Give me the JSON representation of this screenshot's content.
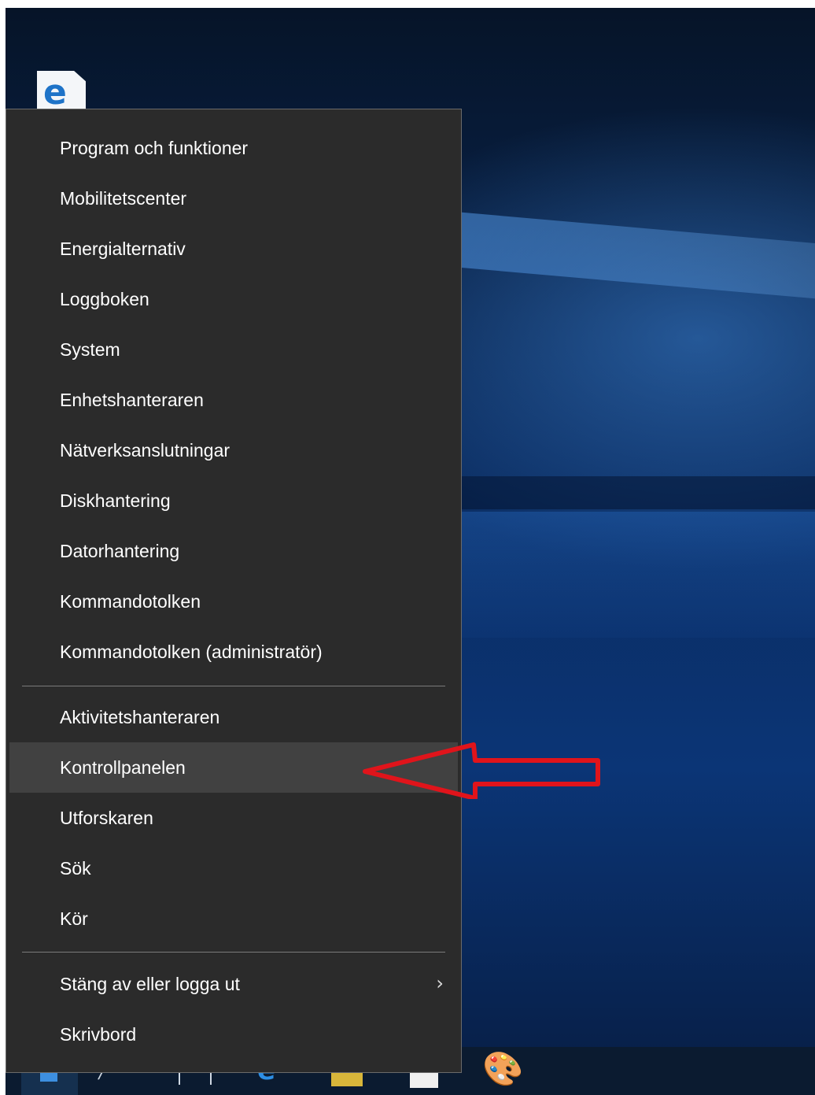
{
  "desktop": {
    "icons": [
      {
        "name": "edge-icon"
      }
    ]
  },
  "context_menu": {
    "items": [
      {
        "label": "Program och funktioner"
      },
      {
        "label": "Mobilitetscenter"
      },
      {
        "label": "Energialternativ"
      },
      {
        "label": "Loggboken"
      },
      {
        "label": "System"
      },
      {
        "label": "Enhetshanteraren"
      },
      {
        "label": "Nätverksanslutningar"
      },
      {
        "label": "Diskhantering"
      },
      {
        "label": "Datorhantering"
      },
      {
        "label": "Kommandotolken"
      },
      {
        "label": "Kommandotolken (administratör)"
      },
      {
        "label": "Aktivitetshanteraren"
      },
      {
        "label": "Kontrollpanelen",
        "highlighted": true
      },
      {
        "label": "Utforskaren"
      },
      {
        "label": "Sök"
      },
      {
        "label": "Kör"
      },
      {
        "label": "Stäng av eller logga ut",
        "has_submenu": true
      },
      {
        "label": "Skrivbord"
      }
    ],
    "submenu_icon": "chevron-right-icon"
  },
  "annotation": {
    "arrow_color": "#e0141b",
    "points_to": "Kontrollpanelen"
  },
  "taskbar": {
    "icons": [
      "windows-start-icon",
      "search-icon",
      "task-view-icon",
      "edge-icon",
      "store-icon",
      "windows-app-icon",
      "paint-icon"
    ]
  },
  "colors": {
    "menu_background": "#2b2b2b",
    "menu_highlight": "#414141",
    "menu_text": "#ffffff"
  }
}
